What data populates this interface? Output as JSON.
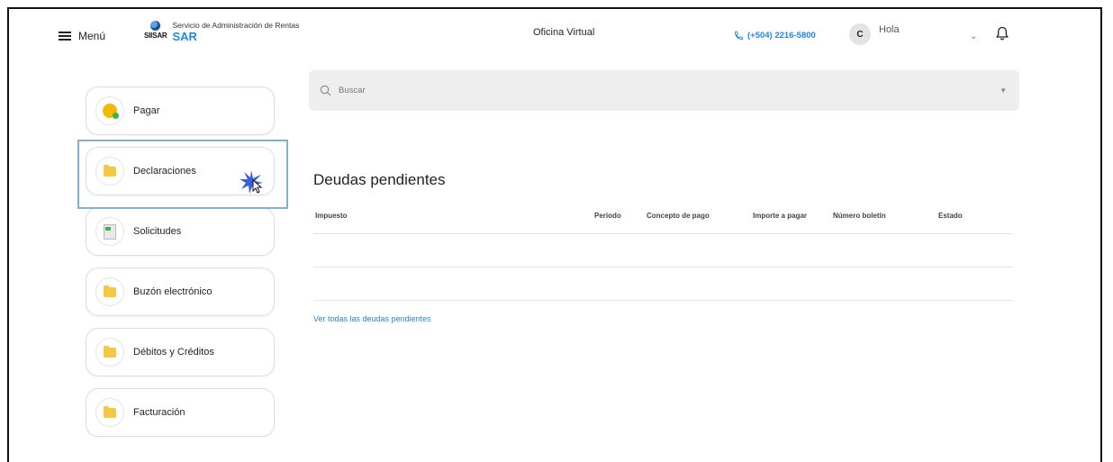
{
  "header": {
    "menu_label": "Menú",
    "logo_small": "SIISAR",
    "org_subtitle": "Servicio de Administración de Rentas",
    "org_name": "SAR",
    "title": "Oficina Virtual",
    "phone": "(+504) 2216-5800",
    "avatar_initial": "C",
    "greeting": "Hola"
  },
  "sidebar": {
    "items": [
      {
        "label": "Pagar",
        "icon": "coin-icon"
      },
      {
        "label": "Declaraciones",
        "icon": "folder-icon"
      },
      {
        "label": "Solicitudes",
        "icon": "document-icon"
      },
      {
        "label": "Buzón electrónico",
        "icon": "folder-icon"
      },
      {
        "label": "Débitos y Créditos",
        "icon": "folder-icon"
      },
      {
        "label": "Facturación",
        "icon": "folder-icon"
      }
    ]
  },
  "search": {
    "placeholder": "Buscar"
  },
  "debts": {
    "title": "Deudas pendientes",
    "columns": [
      "Impuesto",
      "Período",
      "Concepto de pago",
      "Importe a pagar",
      "Número boletín",
      "Estado"
    ],
    "view_all": "Ver todas las deudas pendientes"
  },
  "colors": {
    "accent": "#1e88e5",
    "folder": "#f5c842",
    "highlight": "#7fb3c7"
  }
}
